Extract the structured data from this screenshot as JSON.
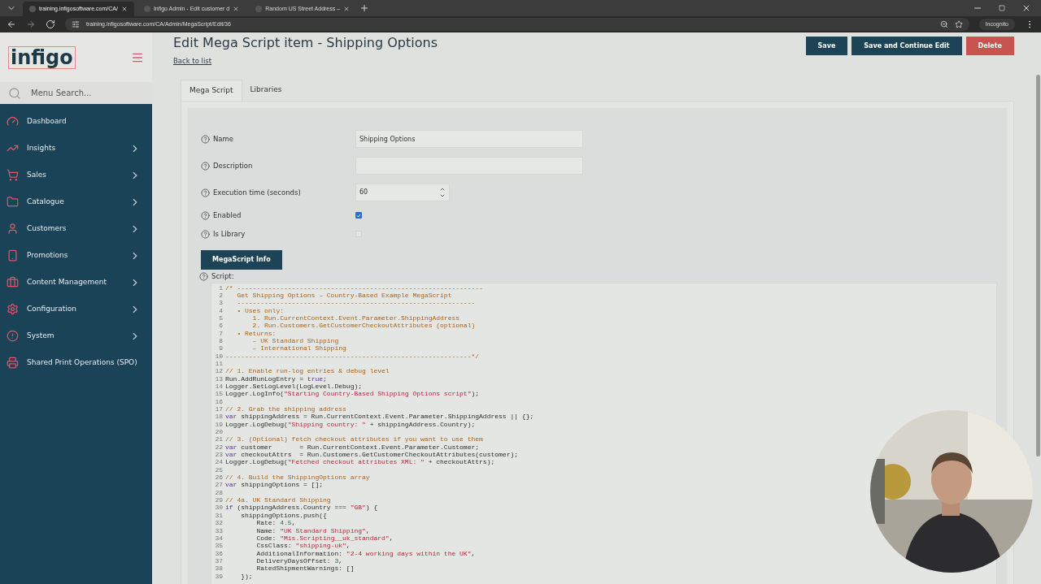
{
  "browser": {
    "tabs": [
      {
        "title": "training.infigosoftware.com/CA/",
        "selected": true
      },
      {
        "title": "Infigo Admin - Edit customer d",
        "selected": false
      },
      {
        "title": "Random US Street Address –",
        "selected": false
      }
    ],
    "url": "training.infigosoftware.com/CA/Admin/MegaScript/Edit/36",
    "profile": "Incognito"
  },
  "sidebar": {
    "logo": "infigo",
    "search_placeholder": "Menu Search...",
    "items": [
      {
        "label": "Dashboard",
        "has_submenu": false
      },
      {
        "label": "Insights",
        "has_submenu": true
      },
      {
        "label": "Sales",
        "has_submenu": true
      },
      {
        "label": "Catalogue",
        "has_submenu": true
      },
      {
        "label": "Customers",
        "has_submenu": true
      },
      {
        "label": "Promotions",
        "has_submenu": true
      },
      {
        "label": "Content Management",
        "has_submenu": true
      },
      {
        "label": "Configuration",
        "has_submenu": true
      },
      {
        "label": "System",
        "has_submenu": true
      },
      {
        "label": "Shared Print Operations (SPO)",
        "has_submenu": false
      }
    ]
  },
  "page": {
    "title": "Edit Mega Script item - Shipping Options",
    "back_link": "Back to list",
    "buttons": [
      {
        "label": "Save",
        "kind": "primary"
      },
      {
        "label": "Save and Continue Edit",
        "kind": "primary"
      },
      {
        "label": "Delete",
        "kind": "danger"
      }
    ],
    "tabs": [
      {
        "label": "Mega Script",
        "selected": true
      },
      {
        "label": "Libraries",
        "selected": false
      }
    ],
    "fields": [
      {
        "label": "Name",
        "kind": "text",
        "value": "Shipping Options"
      },
      {
        "label": "Description",
        "kind": "text"
      },
      {
        "label": "Execution time (seconds)",
        "kind": "number",
        "value": "60"
      },
      {
        "label": "Enabled",
        "kind": "checkbox",
        "checked": true,
        "disabled": false
      },
      {
        "label": "Is Library",
        "kind": "checkbox",
        "checked": false,
        "disabled": true
      }
    ],
    "info_button": "MegaScript Info",
    "script_label": "Script:",
    "code": [
      {
        "number": "1",
        "segments": [
          {
            "kind": "comment",
            "text": "/* ---------------------------------------------------------------"
          }
        ]
      },
      {
        "number": "2",
        "segments": [
          {
            "kind": "comment",
            "text": "   Get Shipping Options – Country-Based Example MegaScript"
          }
        ]
      },
      {
        "number": "3",
        "segments": [
          {
            "kind": "comment",
            "text": "   -------------------------------------------------------------"
          }
        ]
      },
      {
        "number": "4",
        "segments": [
          {
            "kind": "comment",
            "text": "   • Uses only:"
          }
        ]
      },
      {
        "number": "5",
        "segments": [
          {
            "kind": "comment",
            "text": "       1. Run.CurrentContext.Event.Parameter.ShippingAddress"
          }
        ]
      },
      {
        "number": "6",
        "segments": [
          {
            "kind": "comment",
            "text": "       2. Run.Customers.GetCustomerCheckoutAttributes (optional)"
          }
        ]
      },
      {
        "number": "7",
        "segments": [
          {
            "kind": "comment",
            "text": "   • Returns:"
          }
        ]
      },
      {
        "number": "8",
        "segments": [
          {
            "kind": "comment",
            "text": "       – UK Standard Shipping"
          }
        ]
      },
      {
        "number": "9",
        "segments": [
          {
            "kind": "comment",
            "text": "       – International Shipping"
          }
        ]
      },
      {
        "number": "10",
        "segments": [
          {
            "kind": "comment",
            "text": "---------------------------------------------------------------*/"
          }
        ]
      },
      {
        "number": "11"
      },
      {
        "number": "12",
        "segments": [
          {
            "kind": "comment",
            "text": "// 1. Enable run-log entries & debug level"
          }
        ]
      },
      {
        "number": "13",
        "segments": [
          {
            "kind": "plain",
            "text": "Run.AddRunLogEntry = "
          },
          {
            "kind": "keyword",
            "text": "true"
          },
          {
            "kind": "plain",
            "text": ";"
          }
        ]
      },
      {
        "number": "14",
        "segments": [
          {
            "kind": "plain",
            "text": "Logger.SetLogLevel(LogLevel.Debug);"
          }
        ]
      },
      {
        "number": "15",
        "segments": [
          {
            "kind": "plain",
            "text": "Logger.LogInfo("
          },
          {
            "kind": "string",
            "text": "\"Starting Country-Based Shipping Options script\""
          },
          {
            "kind": "plain",
            "text": ");"
          }
        ]
      },
      {
        "number": "16"
      },
      {
        "number": "17",
        "segments": [
          {
            "kind": "comment",
            "text": "// 2. Grab the shipping address"
          }
        ]
      },
      {
        "number": "18",
        "segments": [
          {
            "kind": "keyword",
            "text": "var"
          },
          {
            "kind": "plain",
            "text": " shippingAddress = Run.CurrentContext.Event.Parameter.ShippingAddress || {};"
          }
        ]
      },
      {
        "number": "19",
        "segments": [
          {
            "kind": "plain",
            "text": "Logger.LogDebug("
          },
          {
            "kind": "string",
            "text": "\"Shipping country: \""
          },
          {
            "kind": "plain",
            "text": " + shippingAddress.Country);"
          }
        ]
      },
      {
        "number": "20"
      },
      {
        "number": "21",
        "segments": [
          {
            "kind": "comment",
            "text": "// 3. (Optional) fetch checkout attributes if you want to use them"
          }
        ]
      },
      {
        "number": "22",
        "segments": [
          {
            "kind": "keyword",
            "text": "var"
          },
          {
            "kind": "plain",
            "text": " customer       = Run.CurrentContext.Event.Parameter.Customer;"
          }
        ]
      },
      {
        "number": "23",
        "segments": [
          {
            "kind": "keyword",
            "text": "var"
          },
          {
            "kind": "plain",
            "text": " checkoutAttrs  = Run.Customers.GetCustomerCheckoutAttributes(customer);"
          }
        ]
      },
      {
        "number": "24",
        "segments": [
          {
            "kind": "plain",
            "text": "Logger.LogDebug("
          },
          {
            "kind": "string",
            "text": "\"Fetched checkout attributes XML: \""
          },
          {
            "kind": "plain",
            "text": " + checkoutAttrs);"
          }
        ]
      },
      {
        "number": "25"
      },
      {
        "number": "26",
        "segments": [
          {
            "kind": "comment",
            "text": "// 4. Build the ShippingOptions array"
          }
        ]
      },
      {
        "number": "27",
        "segments": [
          {
            "kind": "keyword",
            "text": "var"
          },
          {
            "kind": "plain",
            "text": " shippingOptions = [];"
          }
        ]
      },
      {
        "number": "28"
      },
      {
        "number": "29",
        "segments": [
          {
            "kind": "comment",
            "text": "// 4a. UK Standard Shipping"
          }
        ]
      },
      {
        "number": "30",
        "segments": [
          {
            "kind": "keyword",
            "text": "if"
          },
          {
            "kind": "plain",
            "text": " (shippingAddress.Country === "
          },
          {
            "kind": "string",
            "text": "\"GB\""
          },
          {
            "kind": "plain",
            "text": ") {"
          }
        ]
      },
      {
        "number": "31",
        "segments": [
          {
            "kind": "plain",
            "text": "    shippingOptions.push({"
          }
        ]
      },
      {
        "number": "32",
        "segments": [
          {
            "kind": "plain",
            "text": "        Rate: "
          },
          {
            "kind": "number",
            "text": "4.5"
          },
          {
            "kind": "plain",
            "text": ","
          }
        ]
      },
      {
        "number": "33",
        "segments": [
          {
            "kind": "plain",
            "text": "        Name: "
          },
          {
            "kind": "string",
            "text": "\"UK Standard Shipping\""
          },
          {
            "kind": "plain",
            "text": ","
          }
        ]
      },
      {
        "number": "34",
        "segments": [
          {
            "kind": "plain",
            "text": "        Code: "
          },
          {
            "kind": "string",
            "text": "\"Mis.Scripting__uk_standard\""
          },
          {
            "kind": "plain",
            "text": ","
          }
        ]
      },
      {
        "number": "35",
        "segments": [
          {
            "kind": "plain",
            "text": "        CssClass: "
          },
          {
            "kind": "string",
            "text": "\"shipping-uk\""
          },
          {
            "kind": "plain",
            "text": ","
          }
        ]
      },
      {
        "number": "36",
        "segments": [
          {
            "kind": "plain",
            "text": "        AdditionalInformation: "
          },
          {
            "kind": "string",
            "text": "\"2-4 working days within the UK\""
          },
          {
            "kind": "plain",
            "text": ","
          }
        ]
      },
      {
        "number": "37",
        "segments": [
          {
            "kind": "plain",
            "text": "        DeliveryDaysOffset: "
          },
          {
            "kind": "number",
            "text": "3"
          },
          {
            "kind": "plain",
            "text": ","
          }
        ]
      },
      {
        "number": "38",
        "segments": [
          {
            "kind": "plain",
            "text": "        RatedShipmentWarnings: []"
          }
        ]
      },
      {
        "number": "39",
        "segments": [
          {
            "kind": "plain",
            "text": "    });"
          }
        ]
      }
    ]
  }
}
